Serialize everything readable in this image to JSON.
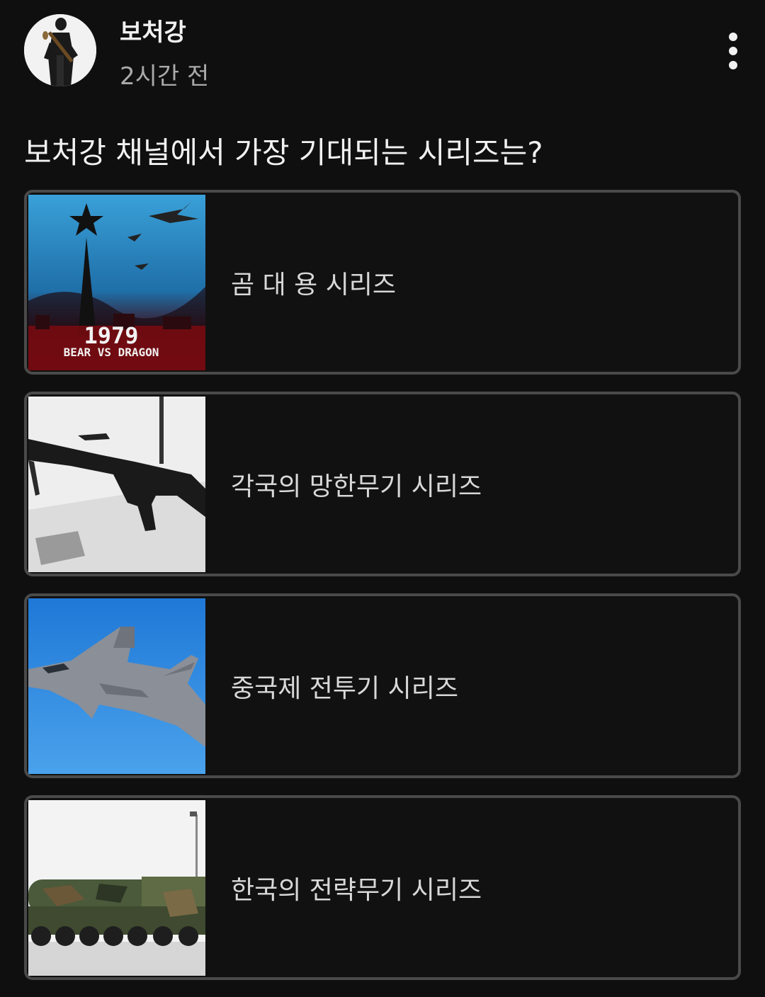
{
  "post": {
    "author": "보처강",
    "time": "2시간 전",
    "more_icon": "more-vertical-icon"
  },
  "poll": {
    "question": "보처강 채널에서 가장 기대되는 시리즈는?",
    "options": [
      {
        "label": "곰 대 용 시리즈",
        "thumb_year": "1979",
        "thumb_caption": "BEAR VS DRAGON"
      },
      {
        "label": "각국의 망한무기 시리즈"
      },
      {
        "label": "중국제 전투기 시리즈"
      },
      {
        "label": "한국의 전략무기 시리즈"
      }
    ]
  },
  "colors": {
    "background": "#0f0f0f",
    "text_primary": "#f1f1f1",
    "text_secondary": "#aaaaaa",
    "option_border": "#4a4a4a"
  }
}
